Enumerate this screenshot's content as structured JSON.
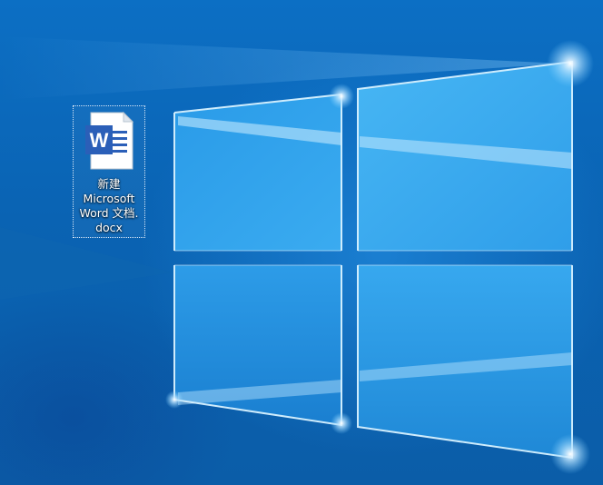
{
  "desktop": {
    "accent_color": "#0a63b3",
    "wallpaper": "windows-10-hero-light-window",
    "icons": [
      {
        "label": "新建\nMicrosoft\nWord 文档.\ndocx",
        "icon": "word-document-icon",
        "badge_letter": "W",
        "selected": true
      }
    ]
  }
}
